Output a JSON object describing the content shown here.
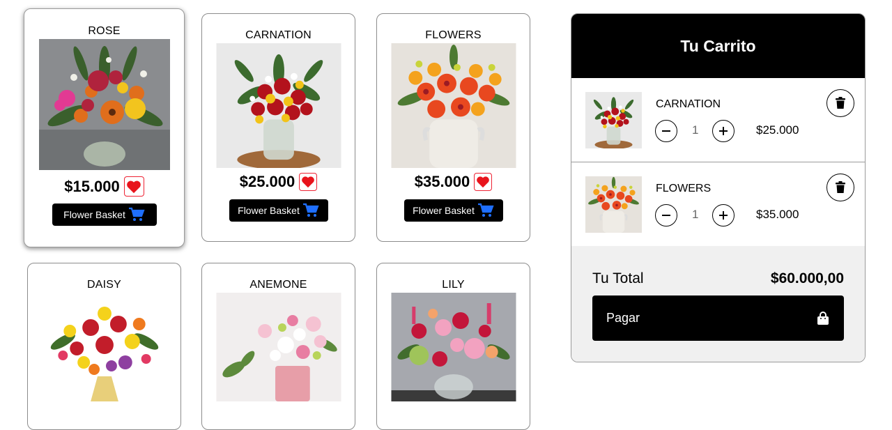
{
  "products": [
    {
      "name": "ROSE",
      "price": "$15.000",
      "button_label": "Flower Basket"
    },
    {
      "name": "CARNATION",
      "price": "$25.000",
      "button_label": "Flower Basket"
    },
    {
      "name": "FLOWERS",
      "price": "$35.000",
      "button_label": "Flower Basket"
    },
    {
      "name": "DAISY"
    },
    {
      "name": "ANEMONE"
    },
    {
      "name": "LILY"
    }
  ],
  "cart": {
    "title": "Tu Carrito",
    "items": [
      {
        "name": "CARNATION",
        "quantity": "1",
        "price": "$25.000"
      },
      {
        "name": "FLOWERS",
        "quantity": "1",
        "price": "$35.000"
      }
    ],
    "total_label": "Tu Total",
    "total_value": "$60.000,00",
    "pay_label": "Pagar"
  },
  "icons": {
    "heart": "heart-icon",
    "cart": "shopping-cart-icon",
    "trash": "trash-icon",
    "minus": "minus-icon",
    "plus": "plus-icon",
    "bag": "shopping-bag-icon"
  },
  "colors": {
    "heart": "#e8141c",
    "cart_icon": "#1f6fff",
    "header_bg": "#000000",
    "footer_bg": "#f0f0f0"
  }
}
